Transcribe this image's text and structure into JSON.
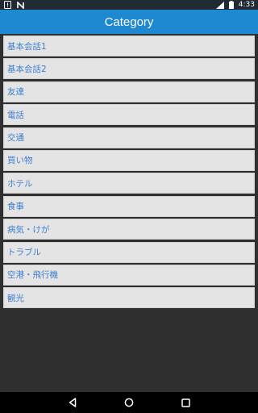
{
  "status_bar": {
    "time": "4:33",
    "icons": [
      "sim-alert-icon",
      "n-logo-icon",
      "signal-icon",
      "battery-icon"
    ]
  },
  "app_bar": {
    "title": "Category"
  },
  "categories": [
    "基本会話1",
    "基本会話2",
    "友達",
    "電話",
    "交通",
    "買い物",
    "ホテル",
    "食事",
    "病気・けが",
    "トラブル",
    "空港・飛行機",
    "観光"
  ],
  "nav_bar": {
    "buttons": [
      "back",
      "home",
      "recents"
    ]
  },
  "colors": {
    "app_bar": "#1e88d0",
    "item_background": "#e4e4e4",
    "item_text": "#3d7fd0",
    "page_background": "#2f2f2f"
  }
}
